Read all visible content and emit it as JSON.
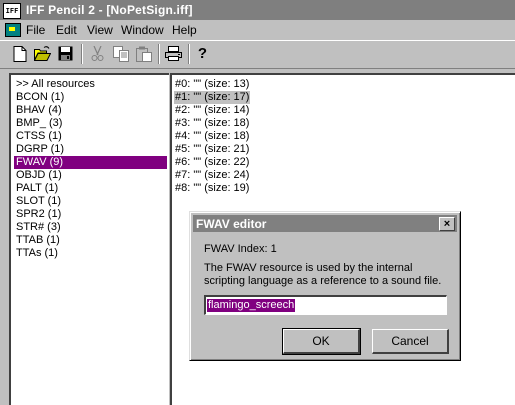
{
  "window": {
    "title": "IFF Pencil 2 - [NoPetSign.iff]",
    "app_icon_text": "IFF"
  },
  "menu": [
    "File",
    "Edit",
    "View",
    "Window",
    "Help"
  ],
  "toolbar": {
    "buttons": [
      "new-file-icon",
      "open-folder-icon",
      "save-disk-icon",
      "cut-icon",
      "copy-icon",
      "paste-icon",
      "print-icon",
      "help-icon"
    ],
    "help_glyph": "?"
  },
  "resource_list": {
    "items": [
      {
        "label": ">> All resources",
        "selected": false
      },
      {
        "label": "BCON (1)",
        "selected": false
      },
      {
        "label": "BHAV (4)",
        "selected": false
      },
      {
        "label": "BMP_ (3)",
        "selected": false
      },
      {
        "label": "CTSS (1)",
        "selected": false
      },
      {
        "label": "DGRP (1)",
        "selected": false
      },
      {
        "label": "FWAV (9)",
        "selected": true
      },
      {
        "label": "OBJD (1)",
        "selected": false
      },
      {
        "label": "PALT (1)",
        "selected": false
      },
      {
        "label": "SLOT (1)",
        "selected": false
      },
      {
        "label": "SPR2 (1)",
        "selected": false
      },
      {
        "label": "STR# (3)",
        "selected": false
      },
      {
        "label": "TTAB (1)",
        "selected": false
      },
      {
        "label": "TTAs (1)",
        "selected": false
      }
    ],
    "selected_color": "#800080"
  },
  "entry_list": {
    "items": [
      {
        "label": "#0: \"\" (size: 13)",
        "selected": false
      },
      {
        "label": "#1: \"\" (size: 17)",
        "selected": true
      },
      {
        "label": "#2: \"\" (size: 14)",
        "selected": false
      },
      {
        "label": "#3: \"\" (size: 18)",
        "selected": false
      },
      {
        "label": "#4: \"\" (size: 18)",
        "selected": false
      },
      {
        "label": "#5: \"\" (size: 21)",
        "selected": false
      },
      {
        "label": "#6: \"\" (size: 22)",
        "selected": false
      },
      {
        "label": "#7: \"\" (size: 24)",
        "selected": false
      },
      {
        "label": "#8: \"\" (size: 19)",
        "selected": false
      }
    ]
  },
  "dialog": {
    "title": "FWAV editor",
    "close_glyph": "×",
    "index_label": "FWAV Index: 1",
    "description_line1": "The FWAV resource is used by the internal",
    "description_line2": "scripting language as a reference to a sound file.",
    "input_value": "flamingo_screech",
    "ok_label": "OK",
    "cancel_label": "Cancel"
  }
}
